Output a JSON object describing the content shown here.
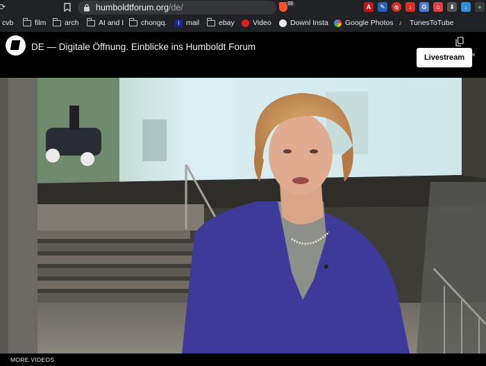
{
  "browser": {
    "url_host": "humboldtforum.org",
    "url_path": "/de/",
    "brave_count": "33",
    "bookmarks": [
      {
        "label": "cvb",
        "type": "folder"
      },
      {
        "label": "film",
        "type": "folder"
      },
      {
        "label": "arch",
        "type": "folder"
      },
      {
        "label": "AI and I",
        "type": "folder"
      },
      {
        "label": "chongq.",
        "type": "folder"
      },
      {
        "label": "mail",
        "type": "site",
        "icon": "mail-icon"
      },
      {
        "label": "ebay",
        "type": "folder"
      },
      {
        "label": "Video",
        "type": "site",
        "icon": "video-icon"
      },
      {
        "label": "Downl Insta",
        "type": "site",
        "icon": "globe-icon"
      },
      {
        "label": "Google Photos",
        "type": "site",
        "icon": "google-photos-icon"
      },
      {
        "label": "TunesToTube",
        "type": "site",
        "icon": "tunestotube-icon"
      }
    ]
  },
  "player": {
    "title": "DE — Digitale Öffnung. Einblicke ins Humboldt Forum",
    "livestream_label": "Livestream",
    "more_videos_label": "MORE VIDEOS",
    "close_glyph": "×"
  },
  "colors": {
    "brave_orange": "#fb542b",
    "blazer_blue": "#3d3a9a"
  }
}
